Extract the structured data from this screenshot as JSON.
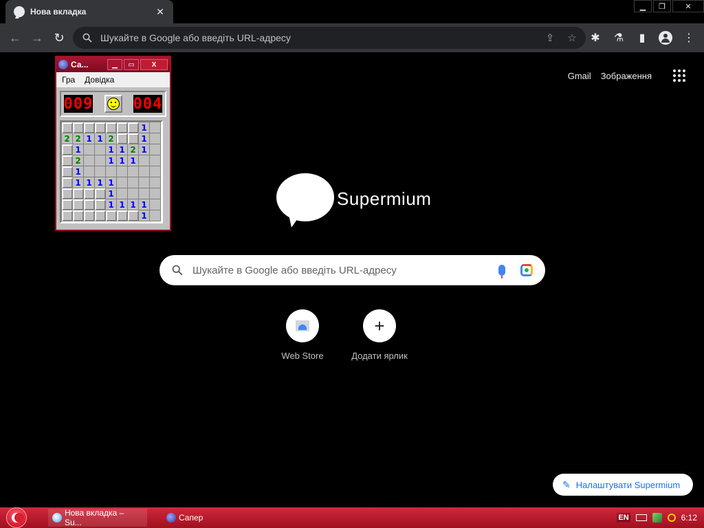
{
  "browser": {
    "tab_title": "Нова вкладка",
    "tab_close": "✕",
    "window_controls": {
      "minimize": "▁",
      "restore": "❐",
      "close": "✕"
    },
    "toolbar": {
      "back": "←",
      "forward": "→",
      "reload": "↻"
    },
    "omnibox_placeholder": "Шукайте в Google або введіть URL-адресу",
    "omnibox_icons": {
      "share": "⇪",
      "bookmark": "☆"
    },
    "right_tools": {
      "extensions": "✱",
      "lab": "⚗",
      "sidepanel": "▮",
      "menu": "⋮"
    }
  },
  "ntp": {
    "links": {
      "gmail": "Gmail",
      "images": "Зображення"
    },
    "logo_text": "Supermium",
    "search_placeholder": "Шукайте в Google або введіть URL-адресу",
    "shortcuts": [
      {
        "label": "Web Store",
        "icon": "web-store-icon"
      },
      {
        "label": "Додати ярлик",
        "icon": "plus-icon",
        "glyph": "+"
      }
    ],
    "customize_label": "Налаштувати Supermium",
    "customize_icon": "✎"
  },
  "minesweeper": {
    "title": "Са...",
    "controls": {
      "minimize": "▁",
      "maximize": "▭",
      "close": "X"
    },
    "menu": [
      "Гра",
      "Довідка"
    ],
    "mines_counter": "009",
    "timer": "004",
    "grid": [
      [
        "#",
        "#",
        "#",
        "#",
        "#",
        "#",
        "#",
        "1",
        " "
      ],
      [
        "2",
        "2",
        "1",
        "1",
        "2",
        "#",
        "#",
        "1",
        " "
      ],
      [
        "#",
        "1",
        " ",
        " ",
        "1",
        "1",
        "2",
        "1",
        " "
      ],
      [
        "#",
        "2",
        " ",
        " ",
        "1",
        "1",
        "1",
        " ",
        " "
      ],
      [
        "#",
        "1",
        " ",
        " ",
        " ",
        " ",
        " ",
        " ",
        " "
      ],
      [
        "#",
        "1",
        "1",
        "1",
        "1",
        " ",
        " ",
        " ",
        " "
      ],
      [
        "#",
        "#",
        "#",
        "#",
        "1",
        " ",
        " ",
        " ",
        " "
      ],
      [
        "#",
        "#",
        "#",
        "#",
        "1",
        "1",
        "1",
        "1",
        " "
      ],
      [
        "#",
        "#",
        "#",
        "#",
        "#",
        "#",
        "#",
        "1",
        " "
      ]
    ]
  },
  "taskbar": {
    "tasks": [
      {
        "label": "Нова вкладка – Su..."
      },
      {
        "label": "Сапер"
      }
    ],
    "lang": "EN",
    "clock": "6:12"
  }
}
